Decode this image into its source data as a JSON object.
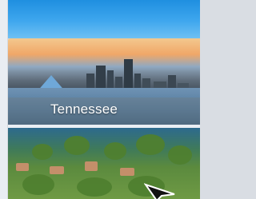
{
  "slide": {
    "caption": "Tennessee"
  },
  "colors": {
    "sky": "#2a97e8",
    "caption_text": "#ffffff",
    "band": "#eaeef3"
  },
  "icons": {
    "cursor": "mouse-pointer-arrow"
  }
}
